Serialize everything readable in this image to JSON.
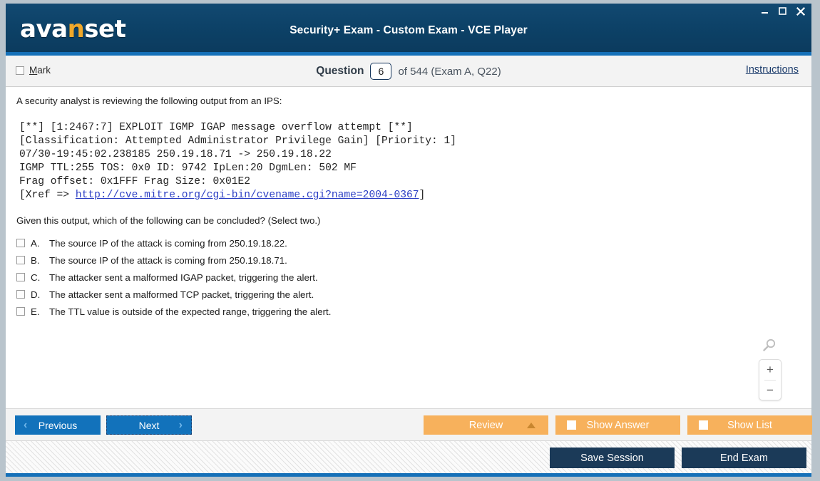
{
  "window": {
    "title": "Security+ Exam - Custom Exam - VCE Player",
    "logo_main_1": "ava",
    "logo_accent": "n",
    "logo_main_2": "set",
    "minimize_label": "Minimize",
    "maximize_label": "Maximize",
    "close_label": "Close"
  },
  "question_bar": {
    "mark_label_underlined": "M",
    "mark_label_rest": "ark",
    "question_word": "Question",
    "question_number": "6",
    "of_text": "of 544 (Exam A, Q22)",
    "instructions_label": "Instructions"
  },
  "content": {
    "stem": "A security analyst is reviewing the following output from an IPS:",
    "ips_output_line1": "[**] [1:2467:7] EXPLOIT IGMP IGAP message overflow attempt [**]",
    "ips_output_line2": "[Classification: Attempted Administrator Privilege Gain] [Priority: 1]",
    "ips_output_line3": "07/30-19:45:02.238185 250.19.18.71 -> 250.19.18.22",
    "ips_output_line4": "IGMP TTL:255 TOS: 0x0 ID: 9742 IpLen:20 DgmLen: 502 MF",
    "ips_output_line5": "Frag offset: 0x1FFF Frag Size: 0x01E2",
    "ips_output_line6_prefix": "[Xref => ",
    "ips_output_link": "http://cve.mitre.org/cgi-bin/cvename.cgi?name=2004-0367",
    "ips_output_line6_suffix": "]",
    "sub_question": "Given this output, which of the following can be concluded? (Select two.)",
    "options": [
      {
        "letter": "A.",
        "text": "The source IP of the attack is coming from 250.19.18.22.",
        "checked": false
      },
      {
        "letter": "B.",
        "text": "The source IP of the attack is coming from 250.19.18.71.",
        "checked": false
      },
      {
        "letter": "C.",
        "text": "The attacker sent a malformed IGAP packet, triggering the alert.",
        "checked": false
      },
      {
        "letter": "D.",
        "text": "The attacker sent a malformed TCP packet, triggering the alert.",
        "checked": false
      },
      {
        "letter": "E.",
        "text": "The TTL value is outside of the expected range, triggering the alert.",
        "checked": false
      }
    ],
    "zoom_in_label": "+",
    "zoom_out_label": "−"
  },
  "navbar": {
    "previous_label": "Previous",
    "previous_chevron": "‹",
    "next_label": "Next",
    "next_chevron": "›",
    "review_label": "Review",
    "show_answer_label": "Show Answer",
    "show_list_label": "Show List"
  },
  "footer": {
    "save_session_label": "Save Session",
    "end_exam_label": "End Exam"
  },
  "colors": {
    "titlebar_navy": "#0d4268",
    "accent_blue": "#1570b8",
    "nav_button_blue": "#1272bb",
    "orange": "#f7b15c",
    "dark_button": "#1b3a58",
    "logo_accent": "#f0a82a",
    "link_blue": "#2b3ec4"
  }
}
